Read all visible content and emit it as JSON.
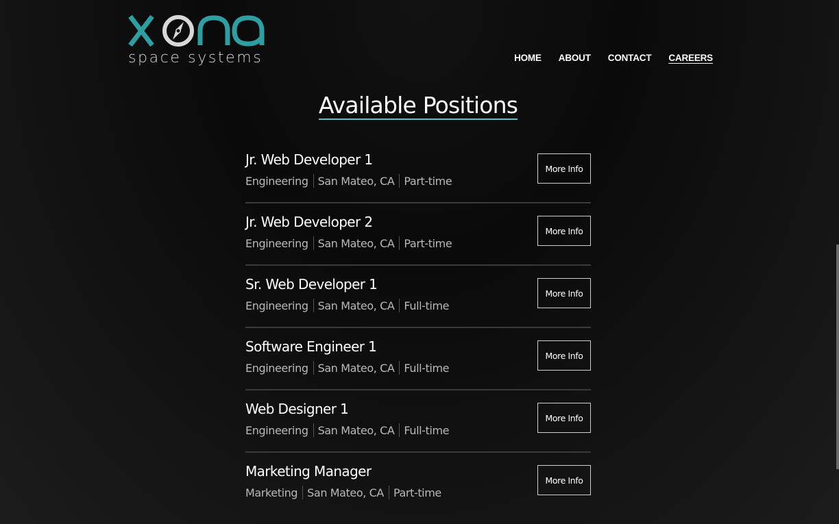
{
  "brand": {
    "logo_text": "xona",
    "tagline": "space systems",
    "accent_color": "#2f9ea3"
  },
  "nav": {
    "items": [
      {
        "label": "HOME",
        "active": false
      },
      {
        "label": "ABOUT",
        "active": false
      },
      {
        "label": "CONTACT",
        "active": false
      },
      {
        "label": "CAREERS",
        "active": true
      }
    ]
  },
  "page_title": "Available Positions",
  "jobs": [
    {
      "title": "Jr. Web Developer 1",
      "department": "Engineering",
      "location": "San Mateo, CA",
      "type": "Part-time",
      "button_label": "More Info"
    },
    {
      "title": "Jr. Web Developer 2",
      "department": "Engineering",
      "location": "San Mateo, CA",
      "type": "Part-time",
      "button_label": "More Info"
    },
    {
      "title": "Sr. Web Developer 1",
      "department": "Engineering",
      "location": "San Mateo, CA",
      "type": "Full-time",
      "button_label": "More Info"
    },
    {
      "title": "Software Engineer 1",
      "department": "Engineering",
      "location": "San Mateo, CA",
      "type": "Full-time",
      "button_label": "More Info"
    },
    {
      "title": "Web Designer 1",
      "department": "Engineering",
      "location": "San Mateo, CA",
      "type": "Full-time",
      "button_label": "More Info"
    },
    {
      "title": "Marketing Manager",
      "department": "Marketing",
      "location": "San Mateo, CA",
      "type": "Part-time",
      "button_label": "More Info"
    }
  ]
}
